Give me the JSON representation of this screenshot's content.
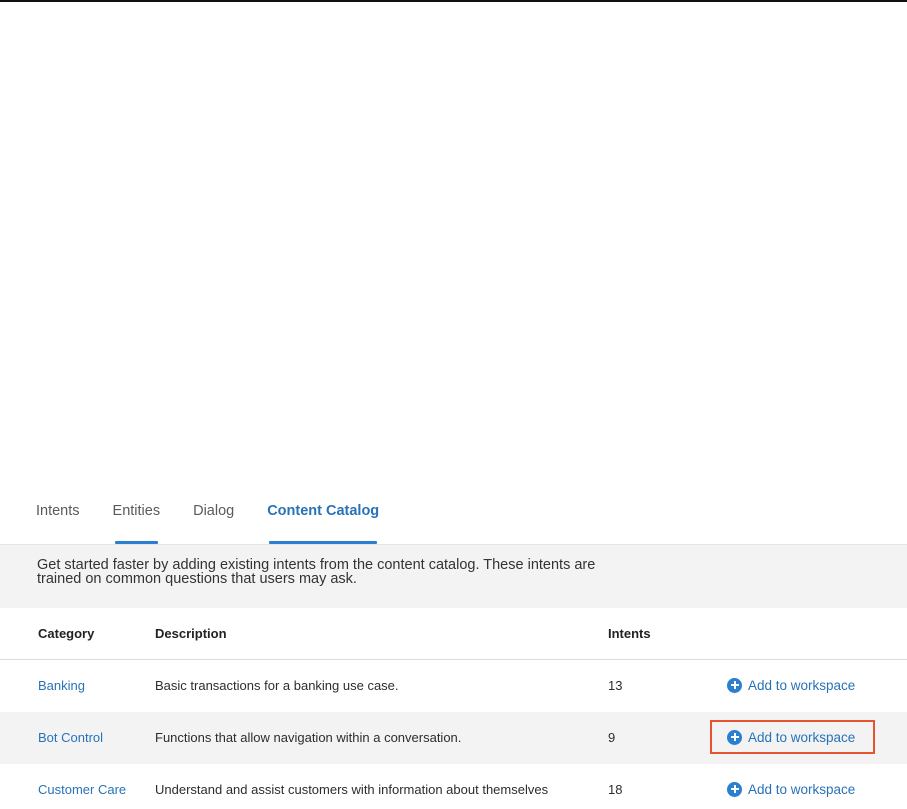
{
  "tabs": [
    {
      "label": "Intents",
      "active": false,
      "underlined": false
    },
    {
      "label": "Entities",
      "active": false,
      "underlined": true
    },
    {
      "label": "Dialog",
      "active": false,
      "underlined": false
    },
    {
      "label": "Content Catalog",
      "active": true,
      "underlined": true
    }
  ],
  "intro": {
    "line1": "Get started faster by adding existing intents from the content catalog. These intents are",
    "line2": "trained on common questions that users may ask."
  },
  "table": {
    "headers": {
      "category": "Category",
      "description": "Description",
      "intents": "Intents"
    },
    "rows": [
      {
        "category": "Banking",
        "description": "Basic transactions for a banking use case.",
        "intents": "13",
        "action": "Add to workspace",
        "highlighted": false
      },
      {
        "category": "Bot Control",
        "description": "Functions that allow navigation within a conversation.",
        "intents": "9",
        "action": "Add to workspace",
        "highlighted": true
      },
      {
        "category": "Customer Care",
        "description": "Understand and assist customers with information about themselves",
        "intents": "18",
        "action": "Add to workspace",
        "highlighted": false
      }
    ]
  },
  "colors": {
    "accent": "#2872b8",
    "highlight_border": "#e5532f",
    "alt_row": "#f3f3f3"
  }
}
